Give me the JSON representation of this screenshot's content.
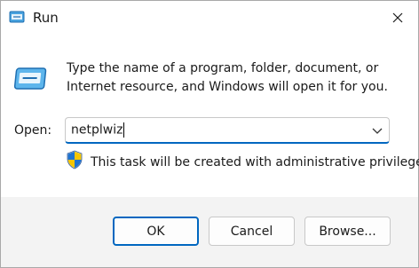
{
  "window": {
    "title": "Run"
  },
  "dialog": {
    "description": "Type the name of a program, folder, document, or Internet resource, and Windows will open it for you.",
    "open_label": "Open:",
    "open_value": "netplwiz",
    "admin_note": "This task will be created with administrative privileges."
  },
  "buttons": {
    "ok": "OK",
    "cancel": "Cancel",
    "browse": "Browse..."
  },
  "icons": {
    "title": "run-icon",
    "close": "close-icon",
    "run_large": "run-icon",
    "dropdown": "chevron-down-icon",
    "shield": "uac-shield-icon"
  },
  "colors": {
    "accent": "#0067c0",
    "footer_bg": "#f3f3f3"
  }
}
